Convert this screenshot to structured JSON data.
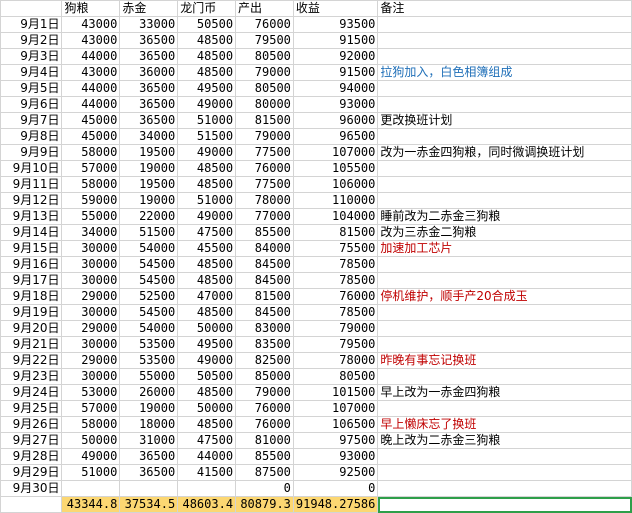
{
  "headers": [
    "",
    "狗粮",
    "赤金",
    "龙门币",
    "产出",
    "收益",
    "备注"
  ],
  "rows": [
    {
      "date": "9月1日",
      "gouliang": "43000",
      "chijin": "33000",
      "longmen": "50500",
      "chanchu": "76000",
      "shouyi": "93500",
      "note": "",
      "note_color": ""
    },
    {
      "date": "9月2日",
      "gouliang": "43000",
      "chijin": "36500",
      "longmen": "48500",
      "chanchu": "79500",
      "shouyi": "91500",
      "note": "",
      "note_color": ""
    },
    {
      "date": "9月3日",
      "gouliang": "44000",
      "chijin": "36500",
      "longmen": "48500",
      "chanchu": "80500",
      "shouyi": "92000",
      "note": "",
      "note_color": ""
    },
    {
      "date": "9月4日",
      "gouliang": "43000",
      "chijin": "36000",
      "longmen": "48500",
      "chanchu": "79000",
      "shouyi": "91500",
      "note": "拉狗加入，白色相簿组成",
      "note_color": "blue"
    },
    {
      "date": "9月5日",
      "gouliang": "44000",
      "chijin": "36500",
      "longmen": "49500",
      "chanchu": "80500",
      "shouyi": "94000",
      "note": "",
      "note_color": ""
    },
    {
      "date": "9月6日",
      "gouliang": "44000",
      "chijin": "36500",
      "longmen": "49000",
      "chanchu": "80000",
      "shouyi": "93000",
      "note": "",
      "note_color": ""
    },
    {
      "date": "9月7日",
      "gouliang": "45000",
      "chijin": "36500",
      "longmen": "51000",
      "chanchu": "81500",
      "shouyi": "96000",
      "note": "更改换班计划",
      "note_color": ""
    },
    {
      "date": "9月8日",
      "gouliang": "45000",
      "chijin": "34000",
      "longmen": "51500",
      "chanchu": "79000",
      "shouyi": "96500",
      "note": "",
      "note_color": ""
    },
    {
      "date": "9月9日",
      "gouliang": "58000",
      "chijin": "19500",
      "longmen": "49000",
      "chanchu": "77500",
      "shouyi": "107000",
      "note": "改为一赤金四狗粮，同时微调换班计划",
      "note_color": ""
    },
    {
      "date": "9月10日",
      "gouliang": "57000",
      "chijin": "19000",
      "longmen": "48500",
      "chanchu": "76000",
      "shouyi": "105500",
      "note": "",
      "note_color": ""
    },
    {
      "date": "9月11日",
      "gouliang": "58000",
      "chijin": "19500",
      "longmen": "48500",
      "chanchu": "77500",
      "shouyi": "106000",
      "note": "",
      "note_color": ""
    },
    {
      "date": "9月12日",
      "gouliang": "59000",
      "chijin": "19000",
      "longmen": "51000",
      "chanchu": "78000",
      "shouyi": "110000",
      "note": "",
      "note_color": ""
    },
    {
      "date": "9月13日",
      "gouliang": "55000",
      "chijin": "22000",
      "longmen": "49000",
      "chanchu": "77000",
      "shouyi": "104000",
      "note": "睡前改为二赤金三狗粮",
      "note_color": ""
    },
    {
      "date": "9月14日",
      "gouliang": "34000",
      "chijin": "51500",
      "longmen": "47500",
      "chanchu": "85500",
      "shouyi": "81500",
      "note": "改为三赤金二狗粮",
      "note_color": ""
    },
    {
      "date": "9月15日",
      "gouliang": "30000",
      "chijin": "54000",
      "longmen": "45500",
      "chanchu": "84000",
      "shouyi": "75500",
      "note": "加速加工芯片",
      "note_color": "red"
    },
    {
      "date": "9月16日",
      "gouliang": "30000",
      "chijin": "54500",
      "longmen": "48500",
      "chanchu": "84500",
      "shouyi": "78500",
      "note": "",
      "note_color": ""
    },
    {
      "date": "9月17日",
      "gouliang": "30000",
      "chijin": "54500",
      "longmen": "48500",
      "chanchu": "84500",
      "shouyi": "78500",
      "note": "",
      "note_color": ""
    },
    {
      "date": "9月18日",
      "gouliang": "29000",
      "chijin": "52500",
      "longmen": "47000",
      "chanchu": "81500",
      "shouyi": "76000",
      "note": "停机维护，顺手产20合成玉",
      "note_color": "red"
    },
    {
      "date": "9月19日",
      "gouliang": "30000",
      "chijin": "54500",
      "longmen": "48500",
      "chanchu": "84500",
      "shouyi": "78500",
      "note": "",
      "note_color": ""
    },
    {
      "date": "9月20日",
      "gouliang": "29000",
      "chijin": "54000",
      "longmen": "50000",
      "chanchu": "83000",
      "shouyi": "79000",
      "note": "",
      "note_color": ""
    },
    {
      "date": "9月21日",
      "gouliang": "30000",
      "chijin": "53500",
      "longmen": "49500",
      "chanchu": "83500",
      "shouyi": "79500",
      "note": "",
      "note_color": ""
    },
    {
      "date": "9月22日",
      "gouliang": "29000",
      "chijin": "53500",
      "longmen": "49000",
      "chanchu": "82500",
      "shouyi": "78000",
      "note": "昨晚有事忘记换班",
      "note_color": "red"
    },
    {
      "date": "9月23日",
      "gouliang": "30000",
      "chijin": "55000",
      "longmen": "50500",
      "chanchu": "85000",
      "shouyi": "80500",
      "note": "",
      "note_color": ""
    },
    {
      "date": "9月24日",
      "gouliang": "53000",
      "chijin": "26000",
      "longmen": "48500",
      "chanchu": "79000",
      "shouyi": "101500",
      "note": "早上改为一赤金四狗粮",
      "note_color": ""
    },
    {
      "date": "9月25日",
      "gouliang": "57000",
      "chijin": "19000",
      "longmen": "50000",
      "chanchu": "76000",
      "shouyi": "107000",
      "note": "",
      "note_color": ""
    },
    {
      "date": "9月26日",
      "gouliang": "58000",
      "chijin": "18000",
      "longmen": "48500",
      "chanchu": "76000",
      "shouyi": "106500",
      "note": "早上懒床忘了换班",
      "note_color": "red"
    },
    {
      "date": "9月27日",
      "gouliang": "50000",
      "chijin": "31000",
      "longmen": "47500",
      "chanchu": "81000",
      "shouyi": "97500",
      "note": "晚上改为二赤金三狗粮",
      "note_color": ""
    },
    {
      "date": "9月28日",
      "gouliang": "49000",
      "chijin": "36500",
      "longmen": "44000",
      "chanchu": "85500",
      "shouyi": "93000",
      "note": "",
      "note_color": ""
    },
    {
      "date": "9月29日",
      "gouliang": "51000",
      "chijin": "36500",
      "longmen": "41500",
      "chanchu": "87500",
      "shouyi": "92500",
      "note": "",
      "note_color": ""
    },
    {
      "date": "9月30日",
      "gouliang": "",
      "chijin": "",
      "longmen": "",
      "chanchu": "0",
      "shouyi": "0",
      "note": "",
      "note_color": ""
    }
  ],
  "averages": {
    "gouliang": "43344.8",
    "chijin": "37534.5",
    "longmen": "48603.4",
    "chanchu": "80879.3",
    "shouyi": "91948.27586"
  },
  "colors": {
    "blue_note": "#1f6fb8",
    "red_note": "#c00000",
    "average_fill": "#fcd772",
    "selection_border": "#2e9f4a"
  }
}
